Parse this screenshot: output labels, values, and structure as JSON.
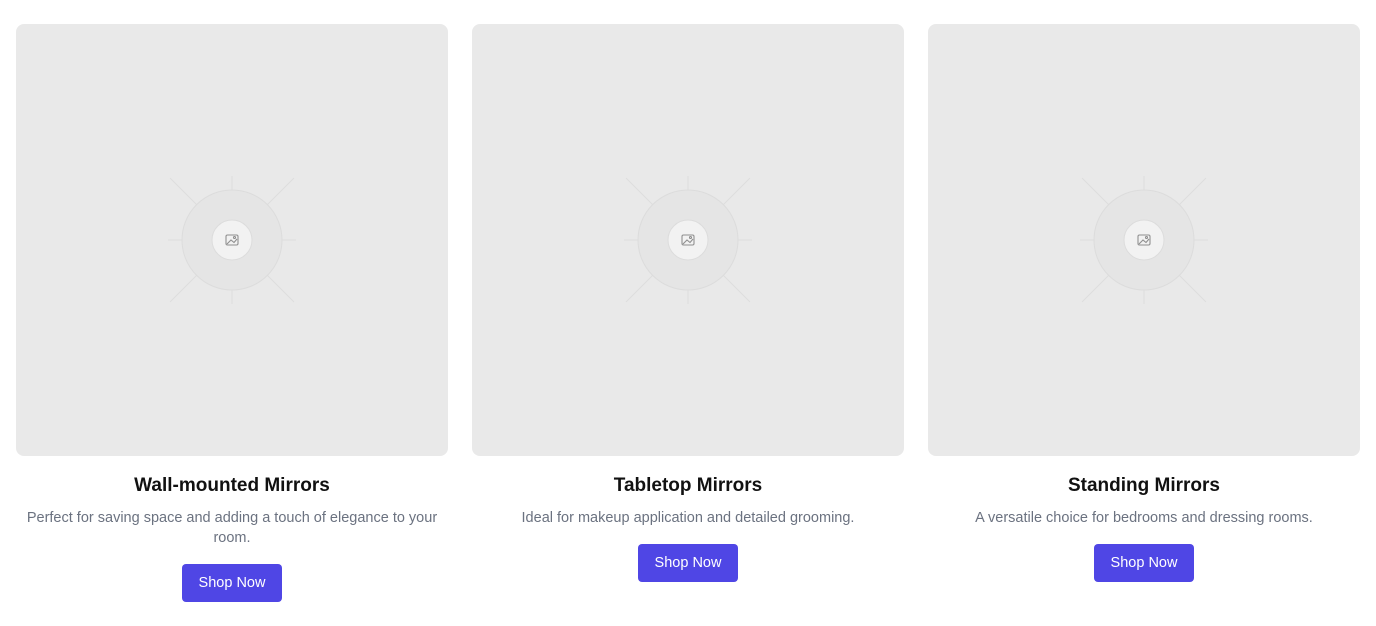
{
  "cards": [
    {
      "image_icon": "image-placeholder-icon",
      "title": "Wall-mounted Mirrors",
      "description": "Perfect for saving space and adding a touch of elegance to your room.",
      "button_label": "Shop Now"
    },
    {
      "image_icon": "image-placeholder-icon",
      "title": "Tabletop Mirrors",
      "description": "Ideal for makeup application and detailed grooming.",
      "button_label": "Shop Now"
    },
    {
      "image_icon": "image-placeholder-icon",
      "title": "Standing Mirrors",
      "description": "A versatile choice for bedrooms and dressing rooms.",
      "button_label": "Shop Now"
    }
  ],
  "colors": {
    "accent": "#4f46e5",
    "image_background": "#e9e9e9",
    "title_text": "#111111",
    "description_text": "#6b7280"
  }
}
